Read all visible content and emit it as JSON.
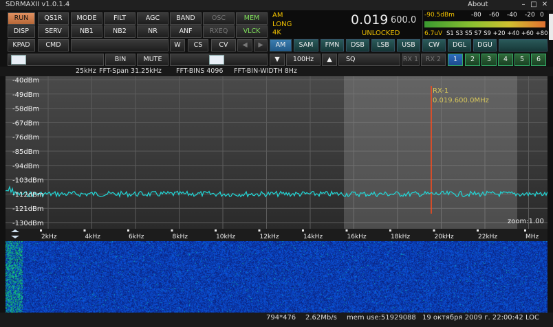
{
  "window": {
    "title": "SDRMAXII v1.0.1.4",
    "about": "About",
    "minimize": "–",
    "maximize": "□",
    "close": "✕"
  },
  "buttons": {
    "row1": [
      "RUN",
      "QS1R",
      "MODE",
      "FILT",
      "AGC",
      "BAND",
      "OSC",
      "MEM"
    ],
    "row2": [
      "DISP",
      "SERV",
      "NB1",
      "NB2",
      "NR",
      "ANF",
      "RXEQ",
      "VLCK"
    ],
    "row3": [
      "KPAD",
      "CMD",
      "W",
      "CS",
      "CV"
    ]
  },
  "info": {
    "mode": "AM",
    "agc": "LONG",
    "bw": "4K",
    "freq_main": "0.019",
    "freq_sub": "600.0",
    "lock": "UNLOCKED"
  },
  "meter": {
    "dbm": "-90.5dBm",
    "uv": "6.7uV",
    "scale_top": [
      "-80",
      "-60",
      "-40",
      "-20",
      "0"
    ],
    "scale_bottom": [
      "S1",
      "S3",
      "S5",
      "S7",
      "S9",
      "+20",
      "+40",
      "+60",
      "+80"
    ]
  },
  "modes": [
    "AM",
    "SAM",
    "FMN",
    "DSB",
    "LSB",
    "USB",
    "CW",
    "DGL",
    "DGU"
  ],
  "controls": {
    "bin": "BIN",
    "mute": "MUTE",
    "step": "100Hz",
    "sq": "SQ",
    "rx1": "RX 1",
    "rx2": "RX 2",
    "numbers": [
      "1",
      "2",
      "3",
      "4",
      "5",
      "6"
    ]
  },
  "fft": {
    "span": "25kHz",
    "fft_span": "FFT-Span 31.25kHz",
    "bins": "FFT-BINS 4096",
    "bin_width": "FFT-BIN-WIDTH 8Hz"
  },
  "spectrum": {
    "db_labels": [
      "-40dBm",
      "-49dBm",
      "-58dBm",
      "-67dBm",
      "-76dBm",
      "-85dBm",
      "-94dBm",
      "-103dBm",
      "-112dBm",
      "-121dBm",
      "-130dBm"
    ],
    "marker_label": "RX-1",
    "marker_freq": "0.019.600.0MHz",
    "zoom": "zoom:1.00",
    "trace_level_dbm": -112
  },
  "axis": {
    "labels": [
      "2kHz",
      "4kHz",
      "6kHz",
      "8kHz",
      "10kHz",
      "12kHz",
      "14kHz",
      "16kHz",
      "18kHz",
      "20kHz",
      "22kHz",
      "MHz"
    ]
  },
  "status": {
    "resolution": "794*476",
    "rate": "2.62Mb/s",
    "mem": "mem use:51929088",
    "datetime": "19 октября 2009 г. 22:00:42 LOC"
  },
  "colors": {
    "accent": "#e09060",
    "trace": "#20d8d8",
    "marker": "#ff4a1a",
    "waterfall": "#0e1f86"
  }
}
